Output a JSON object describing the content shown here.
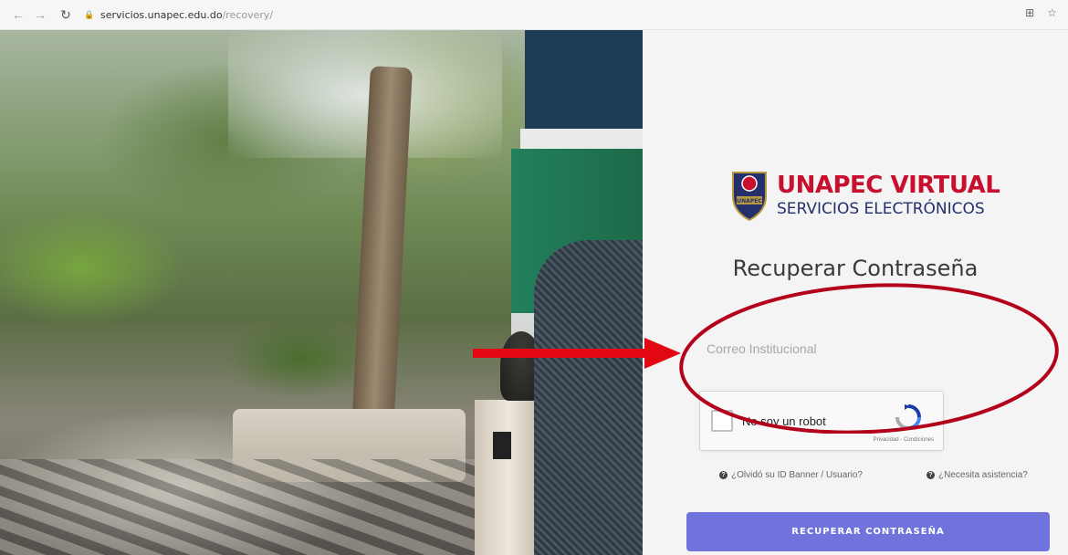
{
  "browser": {
    "url_host": "servicios.unapec.edu.do",
    "url_path": "/recovery/"
  },
  "brand": {
    "name": "UNAPEC VIRTUAL",
    "subtitle": "SERVICIOS ELECTRÓNICOS",
    "shield_text": "UNAPEC"
  },
  "form": {
    "title": "Recuperar Contraseña",
    "email_placeholder": "Correo Institucional",
    "email_value": "",
    "captcha_label": "No soy un robot",
    "captcha_terms": "Privacidad - Condiciones",
    "forgot_link": "¿Olvidó su ID Banner / Usuario?",
    "assist_link": "¿Necesita asistencia?",
    "submit_label": "RECUPERAR CONTRASEÑA"
  },
  "colors": {
    "brand_red": "#c8102e",
    "brand_navy": "#24306b",
    "button": "#6f73db",
    "annotation": "#b3001b"
  }
}
